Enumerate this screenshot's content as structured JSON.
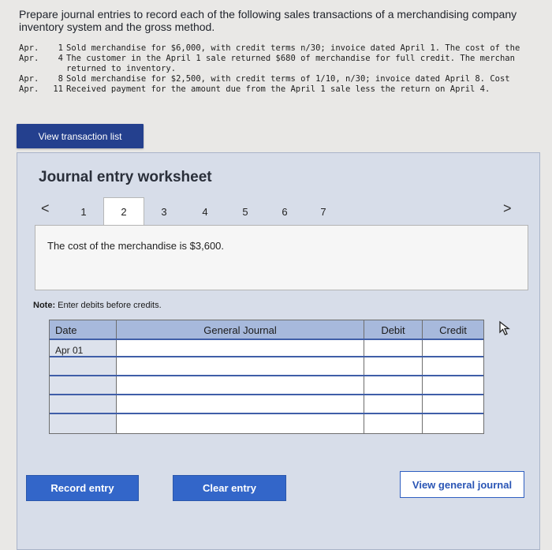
{
  "prompt": {
    "line1": "Prepare journal entries to record each of the following sales transactions of a merchandising company",
    "line2": "inventory system and the gross method."
  },
  "transactions": [
    {
      "month": "Apr.",
      "day": "1",
      "text": "Sold merchandise for $6,000, with credit terms n/30; invoice dated April 1. The cost of the",
      "cont": ""
    },
    {
      "month": "Apr.",
      "day": "4",
      "text": "The customer in the April 1 sale returned $680 of merchandise for full credit. The merchan",
      "cont": "returned to inventory."
    },
    {
      "month": "Apr.",
      "day": "8",
      "text": "Sold merchandise for $2,500, with credit terms of 1/10, n/30; invoice dated April 8. Cost",
      "cont": ""
    },
    {
      "month": "Apr.",
      "day": "11",
      "text": "Received payment for the amount due from the April 1 sale less the return on April 4.",
      "cont": ""
    }
  ],
  "buttons": {
    "view_transaction_list": "View transaction list",
    "record_entry": "Record entry",
    "clear_entry": "Clear entry",
    "view_general_journal": "View general journal"
  },
  "worksheet": {
    "title": "Journal entry worksheet",
    "pages": [
      "1",
      "2",
      "3",
      "4",
      "5",
      "6",
      "7"
    ],
    "active_page": "2",
    "prev_arrow": "<",
    "next_arrow": ">",
    "info_text": "The cost of the merchandise is $3,600.",
    "note_label": "Note:",
    "note_text": " Enter debits before credits."
  },
  "table": {
    "columns": [
      "Date",
      "General Journal",
      "Debit",
      "Credit"
    ],
    "rows": [
      {
        "date": "Apr 01",
        "account": "",
        "debit": "",
        "credit": ""
      },
      {
        "date": "",
        "account": "",
        "debit": "",
        "credit": ""
      },
      {
        "date": "",
        "account": "",
        "debit": "",
        "credit": ""
      },
      {
        "date": "",
        "account": "",
        "debit": "",
        "credit": ""
      },
      {
        "date": "",
        "account": "",
        "debit": "",
        "credit": ""
      },
      {
        "date": "",
        "account": "",
        "debit": "",
        "credit": ""
      }
    ]
  },
  "colors": {
    "primary": "#3366c9",
    "dark_button": "#24408e",
    "table_header": "#a7b9dc",
    "worksheet_bg": "#d7dde9"
  }
}
